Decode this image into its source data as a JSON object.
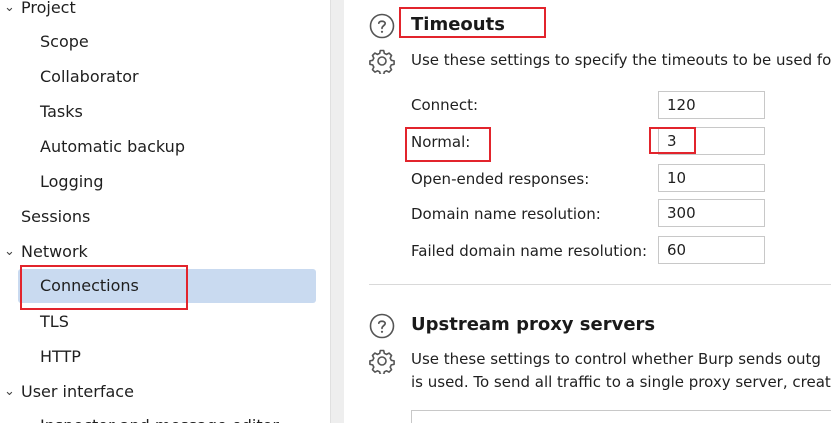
{
  "sidebar": {
    "items": [
      {
        "label": "Project",
        "expanded": true
      },
      {
        "label": "Scope"
      },
      {
        "label": "Collaborator"
      },
      {
        "label": "Tasks"
      },
      {
        "label": "Automatic backup"
      },
      {
        "label": "Logging"
      },
      {
        "label": "Sessions"
      },
      {
        "label": "Network",
        "expanded": true
      },
      {
        "label": "Connections",
        "selected": true
      },
      {
        "label": "TLS"
      },
      {
        "label": "HTTP"
      },
      {
        "label": "User interface",
        "expanded": true
      },
      {
        "label": "Inspector and message editor"
      }
    ]
  },
  "timeouts": {
    "title": "Timeouts",
    "description": "Use these settings to specify the timeouts to be used for",
    "fields": [
      {
        "label": "Connect:",
        "value": "120"
      },
      {
        "label": "Normal:",
        "value": "3"
      },
      {
        "label": "Open-ended responses:",
        "value": "10"
      },
      {
        "label": "Domain name resolution:",
        "value": "300"
      },
      {
        "label": "Failed domain name resolution:",
        "value": "60"
      }
    ]
  },
  "upstream": {
    "title": "Upstream proxy servers",
    "description_line1": "Use these settings to  control whether Burp sends outg",
    "description_line2": "is used. To send all traffic to a single proxy server, creat"
  },
  "icons": {
    "help": "help-circle-icon",
    "settings": "gear-icon",
    "chevron": "chevron-down-icon"
  },
  "colors": {
    "selection": "#c9daf0",
    "highlight": "#e2242c"
  }
}
